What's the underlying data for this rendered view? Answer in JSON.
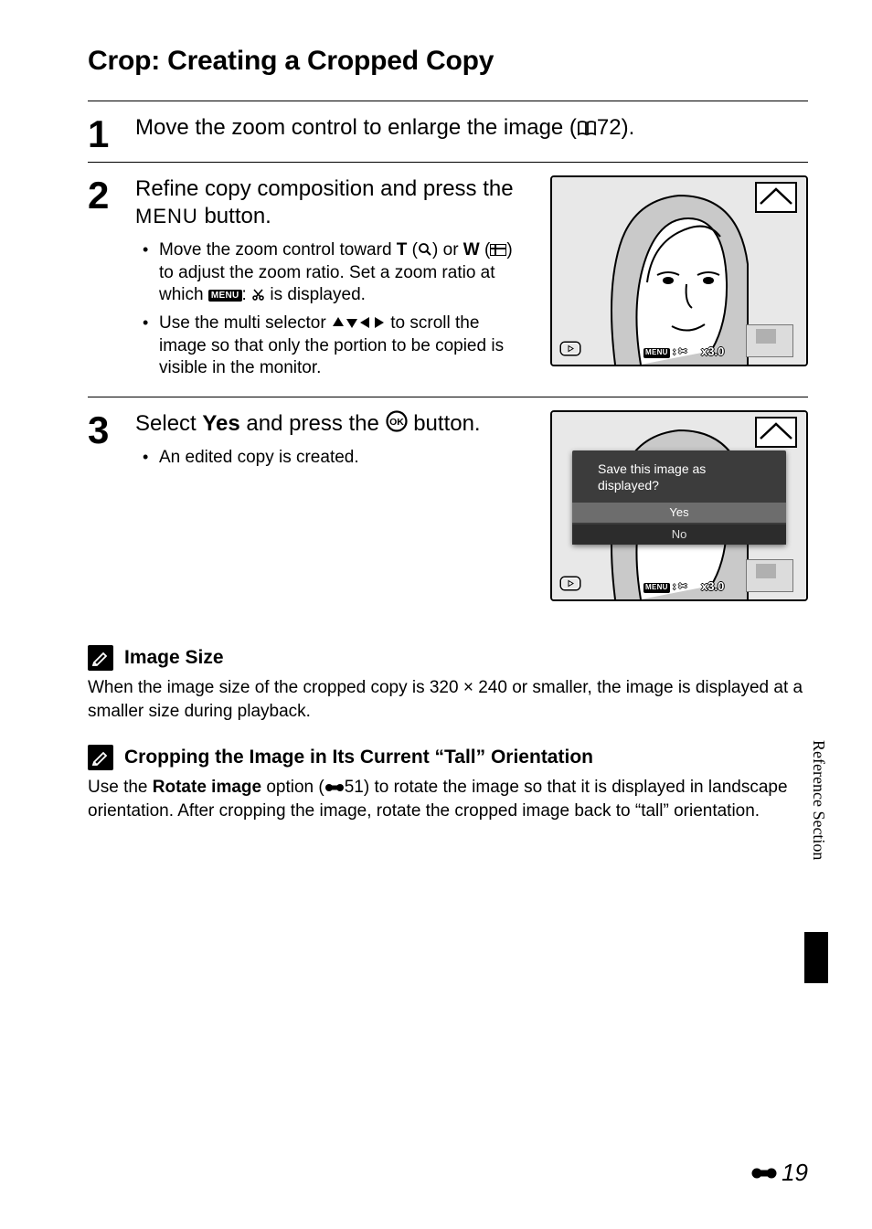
{
  "title": "Crop: Creating a Cropped Copy",
  "steps": [
    {
      "number": "1",
      "heading_parts": {
        "pre": "Move the zoom control to enlarge the image (",
        "ref_icon": "book-icon",
        "ref_num": "72",
        "post": ")."
      }
    },
    {
      "number": "2",
      "heading_parts": {
        "pre": "Refine copy composition and press the ",
        "menu_word": "MENU",
        "post": " button."
      },
      "bullets": [
        {
          "parts": {
            "a": "Move the zoom control toward ",
            "b_bold": "T",
            "c": " (",
            "d_icon": "magnify-icon",
            "e": ") or ",
            "f_bold": "W",
            "g": " (",
            "h_icon": "thumbnail-icon",
            "i": ") to adjust the zoom ratio. Set a zoom ratio at which ",
            "j_icon": "menu-chip-icon",
            "k": ": ",
            "l_icon": "scissors-icon",
            "m": " is displayed."
          }
        },
        {
          "parts": {
            "a": "Use the multi selector ",
            "b_icon": "dpad-icon",
            "c": " to scroll the image so that only the portion to be copied is visible in the monitor."
          }
        }
      ],
      "figure": {
        "zoom_label": "x3.0",
        "menu_hint": "MENU : ✂"
      }
    },
    {
      "number": "3",
      "heading_parts": {
        "pre": "Select ",
        "bold": "Yes",
        "mid": " and press the ",
        "ok_icon": "ok-button-icon",
        "post": " button."
      },
      "bullets_simple": [
        "An edited copy is created."
      ],
      "figure": {
        "dialog_message": "Save this image as displayed?",
        "option_yes": "Yes",
        "option_no": "No",
        "zoom_label": "x3.0",
        "menu_hint": "MENU : ✂"
      }
    }
  ],
  "notes": [
    {
      "title": "Image Size",
      "body": "When the image size of the cropped copy is 320 × 240 or smaller, the image is displayed at a smaller size during playback."
    },
    {
      "title": "Cropping the Image in Its Current “Tall” Orientation",
      "body_parts": {
        "a": "Use the ",
        "b_bold": "Rotate image",
        "c": " option (",
        "d_icon": "reference-link-icon",
        "e": "51) to rotate the image so that it is displayed in landscape orientation. After cropping the image, rotate the cropped image back to “tall” orientation."
      }
    }
  ],
  "side_tab": "Reference Section",
  "page_number": "19"
}
